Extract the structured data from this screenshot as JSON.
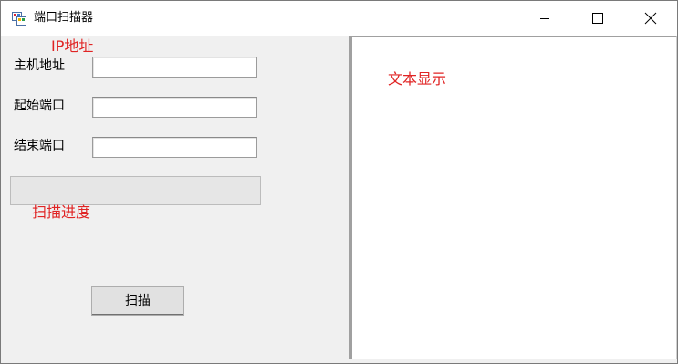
{
  "window": {
    "title": "端口扫描器",
    "controls": {
      "minimize": "minimize-icon",
      "maximize": "maximize-icon",
      "close": "close-icon"
    }
  },
  "form": {
    "host_label": "主机地址",
    "host_value": "",
    "start_port_label": "起始端口",
    "start_port_value": "",
    "end_port_label": "结束端口",
    "end_port_value": "",
    "progress_percent": 0,
    "scan_button": "扫描"
  },
  "annotations": {
    "ip": "IP地址",
    "progress": "扫描进度",
    "text_display": "文本显示"
  },
  "output": {
    "text": ""
  },
  "colors": {
    "annotation": "#e02424",
    "progress_fill": "#06b025"
  }
}
